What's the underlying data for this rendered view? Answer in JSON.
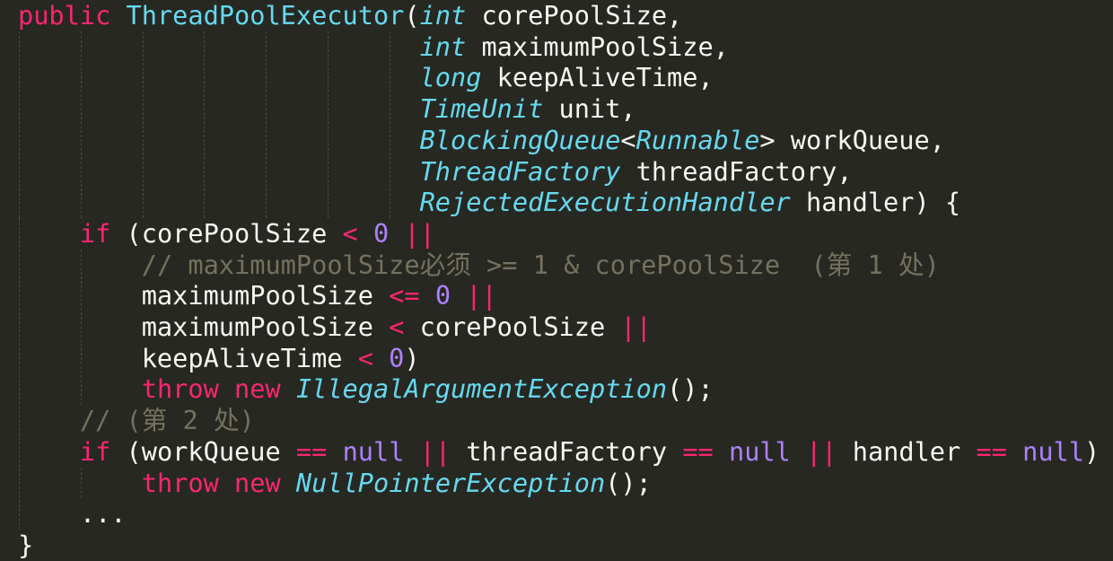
{
  "editor": {
    "theme": "monokai",
    "colors": {
      "background": "#272822",
      "keyword": "#f92672",
      "type": "#66d9ef",
      "number": "#ae81ff",
      "comment": "#75715e",
      "text": "#f8f8f2"
    },
    "lines": [
      {
        "indent": 0,
        "tokens": [
          {
            "t": "public",
            "k": "keyword"
          },
          {
            "t": " ",
            "k": "plain"
          },
          {
            "t": "ThreadPoolExecutor",
            "k": "class"
          },
          {
            "t": "(",
            "k": "plain"
          },
          {
            "t": "int",
            "k": "type"
          },
          {
            "t": " corePoolSize,",
            "k": "plain"
          }
        ]
      },
      {
        "indent": 0,
        "tokens": [
          {
            "t": "                          ",
            "k": "plain"
          },
          {
            "t": "int",
            "k": "type"
          },
          {
            "t": " maximumPoolSize,",
            "k": "plain"
          }
        ]
      },
      {
        "indent": 0,
        "tokens": [
          {
            "t": "                          ",
            "k": "plain"
          },
          {
            "t": "long",
            "k": "type"
          },
          {
            "t": " keepAliveTime,",
            "k": "plain"
          }
        ]
      },
      {
        "indent": 0,
        "tokens": [
          {
            "t": "                          ",
            "k": "plain"
          },
          {
            "t": "TimeUnit",
            "k": "type"
          },
          {
            "t": " unit,",
            "k": "plain"
          }
        ]
      },
      {
        "indent": 0,
        "tokens": [
          {
            "t": "                          ",
            "k": "plain"
          },
          {
            "t": "BlockingQueue",
            "k": "type"
          },
          {
            "t": "<",
            "k": "plain"
          },
          {
            "t": "Runnable",
            "k": "type"
          },
          {
            "t": "> workQueue,",
            "k": "plain"
          }
        ]
      },
      {
        "indent": 0,
        "tokens": [
          {
            "t": "                          ",
            "k": "plain"
          },
          {
            "t": "ThreadFactory",
            "k": "type"
          },
          {
            "t": " threadFactory,",
            "k": "plain"
          }
        ]
      },
      {
        "indent": 0,
        "tokens": [
          {
            "t": "                          ",
            "k": "plain"
          },
          {
            "t": "RejectedExecutionHandler",
            "k": "type"
          },
          {
            "t": " handler) {",
            "k": "plain"
          }
        ]
      },
      {
        "indent": 1,
        "tokens": [
          {
            "t": "    ",
            "k": "plain"
          },
          {
            "t": "if",
            "k": "keyword"
          },
          {
            "t": " (corePoolSize ",
            "k": "plain"
          },
          {
            "t": "<",
            "k": "keyword"
          },
          {
            "t": " ",
            "k": "plain"
          },
          {
            "t": "0",
            "k": "number"
          },
          {
            "t": " ",
            "k": "plain"
          },
          {
            "t": "||",
            "k": "keyword"
          }
        ]
      },
      {
        "indent": 2,
        "tokens": [
          {
            "t": "        ",
            "k": "plain"
          },
          {
            "t": "// maximumPoolSize必须 >= 1 & corePoolSize  (第 1 处)",
            "k": "comment"
          }
        ]
      },
      {
        "indent": 2,
        "tokens": [
          {
            "t": "        maximumPoolSize ",
            "k": "plain"
          },
          {
            "t": "<=",
            "k": "keyword"
          },
          {
            "t": " ",
            "k": "plain"
          },
          {
            "t": "0",
            "k": "number"
          },
          {
            "t": " ",
            "k": "plain"
          },
          {
            "t": "||",
            "k": "keyword"
          }
        ]
      },
      {
        "indent": 2,
        "tokens": [
          {
            "t": "        maximumPoolSize ",
            "k": "plain"
          },
          {
            "t": "<",
            "k": "keyword"
          },
          {
            "t": " corePoolSize ",
            "k": "plain"
          },
          {
            "t": "||",
            "k": "keyword"
          }
        ]
      },
      {
        "indent": 2,
        "tokens": [
          {
            "t": "        keepAliveTime ",
            "k": "plain"
          },
          {
            "t": "<",
            "k": "keyword"
          },
          {
            "t": " ",
            "k": "plain"
          },
          {
            "t": "0",
            "k": "number"
          },
          {
            "t": ")",
            "k": "plain"
          }
        ]
      },
      {
        "indent": 2,
        "tokens": [
          {
            "t": "        ",
            "k": "plain"
          },
          {
            "t": "throw",
            "k": "keyword"
          },
          {
            "t": " ",
            "k": "plain"
          },
          {
            "t": "new",
            "k": "keyword"
          },
          {
            "t": " ",
            "k": "plain"
          },
          {
            "t": "IllegalArgumentException",
            "k": "type"
          },
          {
            "t": "();",
            "k": "plain"
          }
        ]
      },
      {
        "indent": 1,
        "tokens": [
          {
            "t": "    ",
            "k": "plain"
          },
          {
            "t": "// (第 2 处)",
            "k": "comment"
          }
        ]
      },
      {
        "indent": 1,
        "tokens": [
          {
            "t": "    ",
            "k": "plain"
          },
          {
            "t": "if",
            "k": "keyword"
          },
          {
            "t": " (workQueue ",
            "k": "plain"
          },
          {
            "t": "==",
            "k": "keyword"
          },
          {
            "t": " ",
            "k": "plain"
          },
          {
            "t": "null",
            "k": "constant"
          },
          {
            "t": " ",
            "k": "plain"
          },
          {
            "t": "||",
            "k": "keyword"
          },
          {
            "t": " threadFactory ",
            "k": "plain"
          },
          {
            "t": "==",
            "k": "keyword"
          },
          {
            "t": " ",
            "k": "plain"
          },
          {
            "t": "null",
            "k": "constant"
          },
          {
            "t": " ",
            "k": "plain"
          },
          {
            "t": "||",
            "k": "keyword"
          },
          {
            "t": " handler ",
            "k": "plain"
          },
          {
            "t": "==",
            "k": "keyword"
          },
          {
            "t": " ",
            "k": "plain"
          },
          {
            "t": "null",
            "k": "constant"
          },
          {
            "t": ")",
            "k": "plain"
          }
        ]
      },
      {
        "indent": 2,
        "tokens": [
          {
            "t": "        ",
            "k": "plain"
          },
          {
            "t": "throw",
            "k": "keyword"
          },
          {
            "t": " ",
            "k": "plain"
          },
          {
            "t": "new",
            "k": "keyword"
          },
          {
            "t": " ",
            "k": "plain"
          },
          {
            "t": "NullPointerException",
            "k": "type"
          },
          {
            "t": "();",
            "k": "plain"
          }
        ]
      },
      {
        "indent": 1,
        "tokens": [
          {
            "t": "    ...",
            "k": "plain"
          }
        ]
      },
      {
        "indent": 0,
        "tokens": [
          {
            "t": "}",
            "k": "plain"
          }
        ]
      }
    ]
  }
}
